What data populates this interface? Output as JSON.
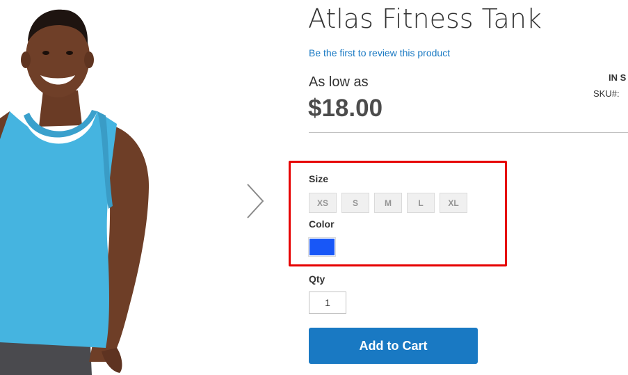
{
  "product": {
    "title": "Atlas Fitness Tank",
    "review_link": "Be the first to review this product",
    "price_prefix": "As low as",
    "price": "$18.00",
    "stock_status": "IN S",
    "sku_label": "SKU#:"
  },
  "gallery": {
    "next_icon": "chevron-right-icon"
  },
  "options": {
    "size_label": "Size",
    "sizes": [
      "XS",
      "S",
      "M",
      "L",
      "XL"
    ],
    "color_label": "Color",
    "color_swatch": "#1857f7"
  },
  "qty": {
    "label": "Qty",
    "value": "1"
  },
  "cart": {
    "add_label": "Add to Cart",
    "button_color": "#1979c3"
  },
  "colors": {
    "link": "#1979c3",
    "highlight_border": "#e60000"
  }
}
